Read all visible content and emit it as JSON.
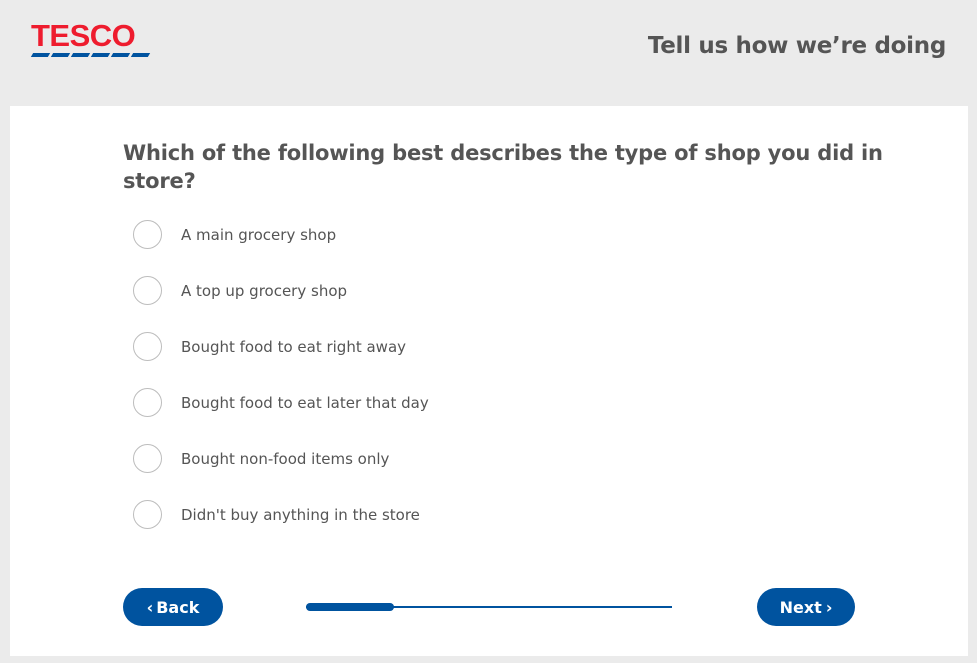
{
  "header": {
    "logo_text": "TESCO",
    "title": "Tell us how we’re doing"
  },
  "colors": {
    "brand_red": "#ee1c2e",
    "brand_blue": "#00539f",
    "text_gray": "#555555"
  },
  "survey": {
    "question": "Which of the following best describes the type of shop you did in store?",
    "options": [
      "A main grocery shop",
      "A top up grocery shop",
      "Bought food to eat right away",
      "Bought food to eat later that day",
      "Bought non-food items only",
      "Didn't buy anything in the store"
    ]
  },
  "nav": {
    "back_label": "Back",
    "next_label": "Next",
    "back_icon": "chevron-left-icon",
    "next_icon": "chevron-right-icon",
    "progress_fraction": 0.24
  }
}
